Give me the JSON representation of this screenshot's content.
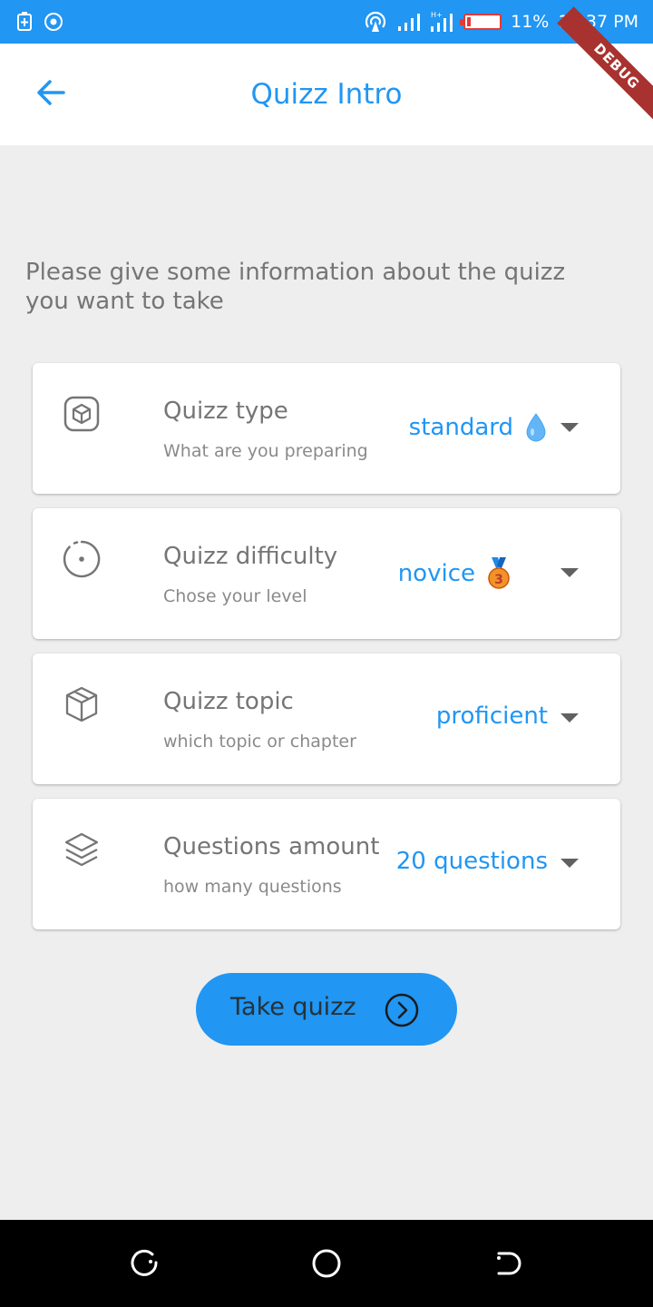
{
  "status_bar": {
    "battery_percent": "11%",
    "time": "12:37 PM",
    "icons": [
      "battery-saver-icon",
      "sync-icon",
      "hotspot-icon",
      "signal-icon",
      "data-signal-icon",
      "battery-icon"
    ]
  },
  "app_bar": {
    "title": "Quizz Intro",
    "back_icon": "arrow-back-icon",
    "debug_banner": "DEBUG"
  },
  "intro_text": "Please give some information about the quizz you want to take",
  "options": [
    {
      "icon": "cube-icon",
      "title": "Quizz type",
      "subtitle": "What are you preparing",
      "value": "standard",
      "value_icon": "droplet-icon"
    },
    {
      "icon": "target-icon",
      "title": "Quizz difficulty",
      "subtitle": "Chose your level",
      "value": "novice",
      "value_icon": "bronze-medal-icon"
    },
    {
      "icon": "box-icon",
      "title": "Quizz topic",
      "subtitle": "which topic or chapter",
      "value": "proficient",
      "value_icon": ""
    },
    {
      "icon": "layers-icon",
      "title": "Questions amount",
      "subtitle": "how many questions",
      "value": "20 questions",
      "value_icon": ""
    }
  ],
  "take_button": {
    "label": "Take quizz",
    "icon": "chevron-right-circle-icon"
  },
  "nav_bar": {
    "icons": [
      "recent-apps-icon",
      "home-icon",
      "back-nav-icon"
    ]
  },
  "colors": {
    "primary": "#2196f3",
    "background": "#eeeeee",
    "text_muted": "#757575",
    "battery_low": "#e53935"
  }
}
